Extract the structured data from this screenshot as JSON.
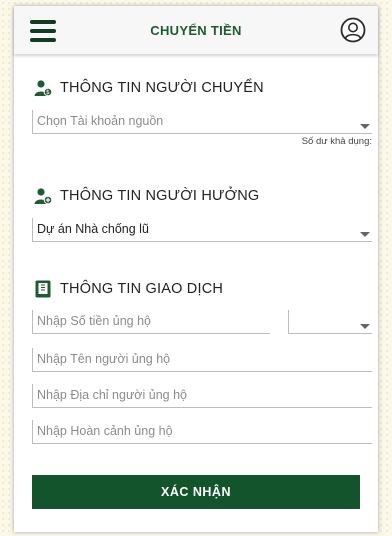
{
  "header": {
    "title": "CHUYỂN TIỀN",
    "menu_icon": "hamburger-menu-icon",
    "avatar_icon": "user-avatar-icon"
  },
  "sender": {
    "title": "THÔNG TIN NGƯỜI CHUYỂN",
    "icon": "person-money-icon",
    "account_placeholder": "Chọn Tài khoản nguồn",
    "balance_label": "Số dư khả dụng:"
  },
  "beneficiary": {
    "title": "THÔNG TIN NGƯỜI HƯỞNG",
    "icon": "person-add-icon",
    "selected_value": "Dự án Nhà chống lũ"
  },
  "transaction": {
    "title": "THÔNG TIN GIAO DỊCH",
    "icon": "document-icon",
    "amount_placeholder": "Nhập Số tiền ủng hộ",
    "currency_value": "",
    "name_placeholder": "Nhập Tên người ủng hộ",
    "address_placeholder": "Nhập Địa chỉ người ủng hộ",
    "situation_placeholder": "Nhập Hoàn cảnh ủng hộ"
  },
  "actions": {
    "confirm_label": "XÁC NHẬN"
  },
  "colors": {
    "primary": "#14542d",
    "header_title": "#1f5a34",
    "page_background": "#fbf8e9"
  }
}
